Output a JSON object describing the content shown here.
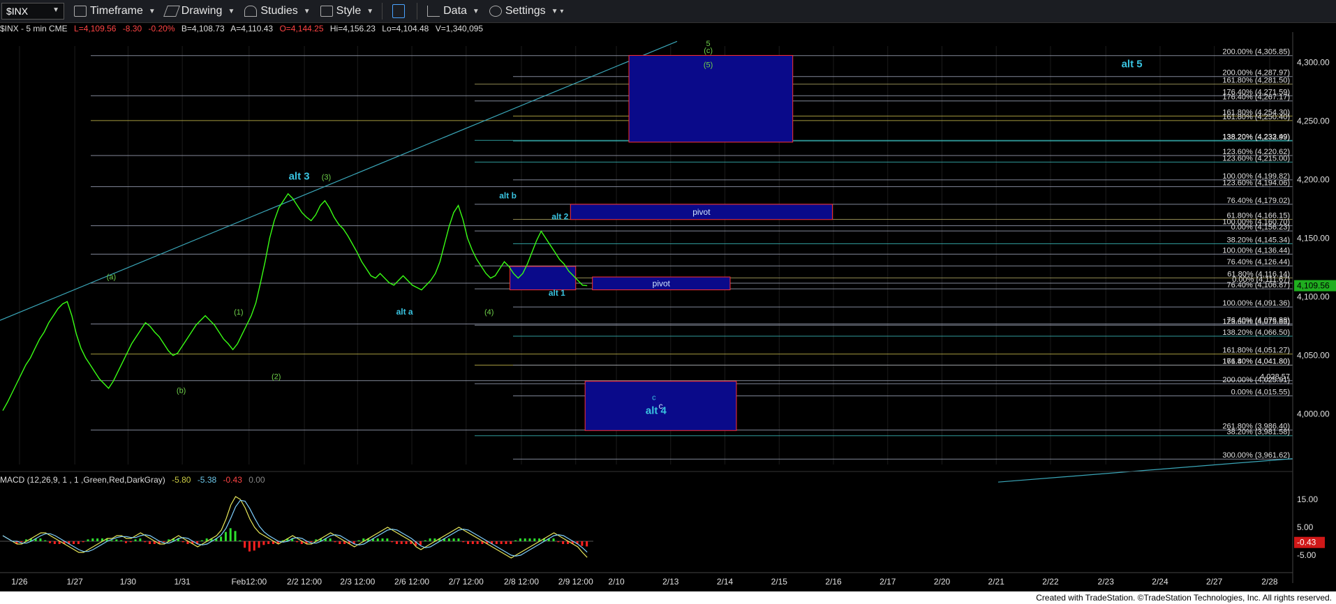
{
  "toolbar": {
    "symbol": "$INX",
    "timeframe": "Timeframe",
    "drawing": "Drawing",
    "studies": "Studies",
    "style": "Style",
    "data": "Data",
    "settings": "Settings"
  },
  "header": {
    "symbol_info": "$INX - 5 min  CME",
    "last": "L=4,109.56",
    "change": "-8.30",
    "change_pct": "-0.20%",
    "bid": "B=4,108.73",
    "ask": "A=4,110.43",
    "open": "O=4,144.25",
    "high": "Hi=4,156.23",
    "low": "Lo=4,104.48",
    "volume": "V=1,340,095"
  },
  "price_axis": [
    {
      "label": "4,300.00",
      "v": 4300
    },
    {
      "label": "4,250.00",
      "v": 4250
    },
    {
      "label": "4,200.00",
      "v": 4200
    },
    {
      "label": "4,150.00",
      "v": 4150
    },
    {
      "label": "4,100.00",
      "v": 4100
    },
    {
      "label": "4,050.00",
      "v": 4050
    },
    {
      "label": "4,000.00",
      "v": 4000
    }
  ],
  "current_price": "4,109.56",
  "fib_levels": [
    {
      "label": "200.00% (4,305.85)",
      "v": 4305.85,
      "color": "#9aa0b4"
    },
    {
      "label": "161.80% (4,281.50)",
      "v": 4281.5,
      "color": "#a9a060"
    },
    {
      "label": "200.00% (4,287.97)",
      "v": 4287.97,
      "color": "#9aa0b4"
    },
    {
      "label": "176.40% (4,271.59)",
      "v": 4271.59,
      "color": "#9aa0b4"
    },
    {
      "label": "176.40% (4,267.17)",
      "v": 4267.17,
      "color": "#9aa0b4"
    },
    {
      "label": "161.80% (4,254.30)",
      "v": 4254.3,
      "color": "#c2b44a"
    },
    {
      "label": "161.80% (4,250.40)",
      "v": 4250.4,
      "color": "#c2b44a"
    },
    {
      "label": "138.20% (4,233.49)",
      "v": 4233.49,
      "color": "#38b6b6"
    },
    {
      "label": "138.20% (4,232.99)",
      "v": 4232.99,
      "color": "#38b6b6"
    },
    {
      "label": "123.60% (4,220.62)",
      "v": 4220.62,
      "color": "#9aa0b4"
    },
    {
      "label": "123.60% (4,215.00)",
      "v": 4215.0,
      "color": "#38b6b6"
    },
    {
      "label": "100.00% (4,199.82)",
      "v": 4199.82,
      "color": "#9aa0b4"
    },
    {
      "label": "123.60% (4,194.06)",
      "v": 4194.06,
      "color": "#9aa0b4"
    },
    {
      "label": "76.40% (4,179.02)",
      "v": 4179.02,
      "color": "#9aa0b4"
    },
    {
      "label": "61.80% (4,166.15)",
      "v": 4166.15,
      "color": "#a9a060"
    },
    {
      "label": "100.00% (4,160.70)",
      "v": 4160.7,
      "color": "#9aa0b4"
    },
    {
      "label": "0.00% (4,156.23)",
      "v": 4156.23,
      "color": "#9aa0b4"
    },
    {
      "label": "38.20% (4,145.34)",
      "v": 4145.34,
      "color": "#38b6b6"
    },
    {
      "label": "100.00% (4,136.44)",
      "v": 4136.44,
      "color": "#9aa0b4"
    },
    {
      "label": "76.40% (4,126.44)",
      "v": 4126.44,
      "color": "#9aa0b4"
    },
    {
      "label": "61.80% (4,116.14)",
      "v": 4116.14,
      "color": "#a9a060"
    },
    {
      "label": "0.00% (4,111.67)",
      "v": 4111.67,
      "color": "#9aa0b4"
    },
    {
      "label": "76.40% (4,106.87)",
      "v": 4106.87,
      "color": "#9aa0b4"
    },
    {
      "label": "100.00% (4,091.36)",
      "v": 4091.36,
      "color": "#9aa0b4"
    },
    {
      "label": "76.40% (4,076.88)",
      "v": 4076.88,
      "color": "#9aa0b4"
    },
    {
      "label": "123.60% (4,075.83)",
      "v": 4075.83,
      "color": "#9aa0b4"
    },
    {
      "label": "138.20% (4,066.50)",
      "v": 4066.5,
      "color": "#38b6b6"
    },
    {
      "label": "161.80% (4,051.27)",
      "v": 4051.27,
      "color": "#c2b44a"
    },
    {
      "label": "161.80% (4,041.80)",
      "v": 4041.8,
      "color": "#c2b44a"
    },
    {
      "label": "176.40% (4,041.80)",
      "v": 4041.8,
      "color": "#9aa0b4"
    },
    {
      "label": "4,028.57",
      "v": 4028.57,
      "color": "#9aa0b4"
    },
    {
      "label": "200.00% (4,025.91)",
      "v": 4025.91,
      "color": "#9aa0b4"
    },
    {
      "label": "0.00% (4,015.55)",
      "v": 4015.55,
      "color": "#9aa0b4"
    },
    {
      "label": "261.80% (3,986.40)",
      "v": 3986.4,
      "color": "#9aa0b4"
    },
    {
      "label": "38.20% (3,981.58)",
      "v": 3981.58,
      "color": "#38b6b6"
    },
    {
      "label": "300.00% (3,961.62)",
      "v": 3961.62,
      "color": "#9aa0b4"
    }
  ],
  "wave_labels": [
    {
      "text": "(a)",
      "color": "#6fd14a",
      "i": 104,
      "v": 4115
    },
    {
      "text": "(b)",
      "color": "#6fd14a",
      "i": 171,
      "v": 4018
    },
    {
      "text": "(1)",
      "color": "#6fd14a",
      "i": 226,
      "v": 4085
    },
    {
      "text": "(2)",
      "color": "#6fd14a",
      "i": 262,
      "v": 4030
    },
    {
      "text": "alt 3",
      "color": "#39c3e0",
      "i": 284,
      "v": 4200
    },
    {
      "text": "(3)",
      "color": "#6fd14a",
      "i": 310,
      "v": 4200
    },
    {
      "text": "alt a",
      "color": "#39c3e0",
      "i": 385,
      "v": 4085
    },
    {
      "text": "(4)",
      "color": "#6fd14a",
      "i": 466,
      "v": 4085
    },
    {
      "text": "alt b",
      "color": "#39c3e0",
      "i": 484,
      "v": 4184
    },
    {
      "text": "alt 2",
      "color": "#39c3e0",
      "i": 534,
      "v": 4166
    },
    {
      "text": "alt 1",
      "color": "#39c3e0",
      "i": 531,
      "v": 4101
    },
    {
      "text": "5",
      "color": "#6fd14a",
      "i": 676,
      "v": 4314
    },
    {
      "text": "(c)",
      "color": "#6fd14a",
      "i": 676,
      "v": 4308
    },
    {
      "text": "(5)",
      "color": "#6fd14a",
      "i": 676,
      "v": 4296
    },
    {
      "text": "alt 5",
      "color": "#39c3e0",
      "i": 1082,
      "v": 4296
    },
    {
      "text": "c",
      "color": "#39c3e0",
      "i": 624,
      "v": 4012
    },
    {
      "text": "alt 4",
      "color": "#39c3e0",
      "i": 626,
      "v": 4000
    }
  ],
  "zones": [
    {
      "label": "",
      "i0": 600,
      "i1": 757,
      "v0": 4306,
      "v1": 4232
    },
    {
      "label": "pivot",
      "i0": 544,
      "i1": 795,
      "v0": 4179,
      "v1": 4166
    },
    {
      "label": "pivot",
      "i0": 565,
      "i1": 697,
      "v0": 4117,
      "v1": 4106
    },
    {
      "label": "c",
      "i0": 558,
      "i1": 703,
      "v0": 4028,
      "v1": 3986
    },
    {
      "label": "",
      "i0": 486,
      "i1": 549,
      "v0": 4126,
      "v1": 4106
    }
  ],
  "x_axis": [
    {
      "label": "1/26",
      "i": 16
    },
    {
      "label": "1/27",
      "i": 69
    },
    {
      "label": "1/30",
      "i": 120
    },
    {
      "label": "1/31",
      "i": 172
    },
    {
      "label": "Feb12:00",
      "i": 236
    },
    {
      "label": "2/2 12:00",
      "i": 289
    },
    {
      "label": "2/3 12:00",
      "i": 340
    },
    {
      "label": "2/6 12:00",
      "i": 392
    },
    {
      "label": "2/7 12:00",
      "i": 444
    },
    {
      "label": "2/8 12:00",
      "i": 497
    },
    {
      "label": "2/9 12:00",
      "i": 549
    },
    {
      "label": "2/10",
      "i": 588
    },
    {
      "label": "2/13",
      "i": 640
    },
    {
      "label": "2/14",
      "i": 692
    },
    {
      "label": "2/15",
      "i": 744
    },
    {
      "label": "2/16",
      "i": 796
    },
    {
      "label": "2/17",
      "i": 848
    },
    {
      "label": "2/20",
      "i": 900
    },
    {
      "label": "2/21",
      "i": 952
    },
    {
      "label": "2/22",
      "i": 1004
    },
    {
      "label": "2/23",
      "i": 1057
    },
    {
      "label": "2/24",
      "i": 1109
    },
    {
      "label": "2/27",
      "i": 1161
    },
    {
      "label": "2/28",
      "i": 1214
    }
  ],
  "macd": {
    "title": "MACD (12,26,9, 1 , 1 ,Green,Red,DarkGray)",
    "v1": "-5.80",
    "v2": "-5.38",
    "v3": "-0.43",
    "v4": "0.00",
    "axis": [
      {
        "label": "15.00",
        "v": 15
      },
      {
        "label": "5.00",
        "v": 5
      },
      {
        "label": "-5.00",
        "v": -5
      }
    ],
    "current": "-0.43"
  },
  "price_series": [
    4003,
    4010,
    4018,
    4026,
    4034,
    4042,
    4048,
    4056,
    4064,
    4070,
    4078,
    4084,
    4090,
    4094,
    4096,
    4084,
    4068,
    4056,
    4048,
    4042,
    4036,
    4030,
    4026,
    4022,
    4028,
    4036,
    4044,
    4052,
    4060,
    4066,
    4072,
    4078,
    4075,
    4070,
    4066,
    4060,
    4054,
    4050,
    4052,
    4058,
    4064,
    4070,
    4076,
    4080,
    4084,
    4080,
    4076,
    4070,
    4064,
    4060,
    4055,
    4060,
    4068,
    4076,
    4084,
    4095,
    4112,
    4130,
    4150,
    4165,
    4176,
    4182,
    4188,
    4184,
    4178,
    4172,
    4168,
    4165,
    4170,
    4178,
    4182,
    4176,
    4168,
    4162,
    4158,
    4152,
    4145,
    4138,
    4130,
    4124,
    4118,
    4116,
    4120,
    4116,
    4112,
    4110,
    4114,
    4118,
    4114,
    4110,
    4108,
    4106,
    4110,
    4114,
    4120,
    4130,
    4145,
    4160,
    4172,
    4178,
    4166,
    4150,
    4140,
    4132,
    4126,
    4120,
    4116,
    4118,
    4124,
    4130,
    4126,
    4120,
    4116,
    4120,
    4128,
    4138,
    4148,
    4156,
    4150,
    4144,
    4138,
    4132,
    4128,
    4122,
    4118,
    4114,
    4110,
    4109.56
  ],
  "macd_series": [
    2,
    1,
    0,
    -1,
    -1,
    0,
    1,
    2,
    3,
    3,
    2,
    1,
    0,
    -1,
    -2,
    -3,
    -4,
    -4,
    -3,
    -2,
    -1,
    0,
    1,
    1,
    2,
    2,
    1,
    1,
    2,
    3,
    2,
    1,
    0,
    -1,
    -1,
    0,
    1,
    2,
    1,
    0,
    -1,
    -2,
    -1,
    0,
    1,
    2,
    4,
    8,
    13,
    16,
    15,
    12,
    8,
    5,
    3,
    2,
    1,
    0,
    -1,
    0,
    1,
    2,
    1,
    0,
    -1,
    -1,
    0,
    1,
    2,
    3,
    2,
    1,
    0,
    -1,
    -2,
    -1,
    0,
    1,
    2,
    3,
    4,
    5,
    4,
    3,
    2,
    1,
    0,
    -2,
    -3,
    -2,
    -1,
    0,
    1,
    2,
    3,
    4,
    5,
    4,
    3,
    2,
    1,
    0,
    -1,
    -2,
    -3,
    -4,
    -5,
    -6,
    -5,
    -4,
    -3,
    -2,
    -1,
    0,
    1,
    2,
    3,
    2,
    1,
    0,
    -1,
    -2,
    -4,
    -5.8
  ]
}
